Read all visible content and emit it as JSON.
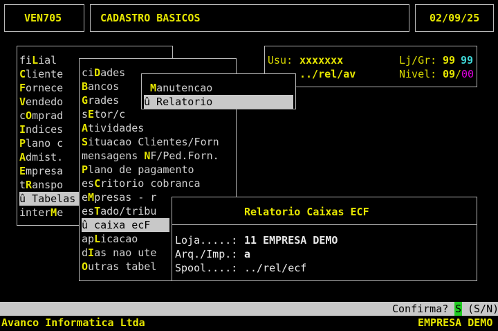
{
  "header": {
    "program": "VEN705",
    "title": "CADASTRO BASICOS",
    "date": "02/09/25"
  },
  "info": {
    "usu_label": "Usu:",
    "usu_value": "xxxxxxx",
    "ljgr_label": "Lj/Gr:",
    "ljgr_value1": "99",
    "ljgr_value2": "99",
    "path": "../rel/av",
    "nivel_label": "Nivel:",
    "nivel_value1": "09",
    "nivel_sep": "/",
    "nivel_value2": "00"
  },
  "menu1": {
    "items": [
      {
        "pre": "fi",
        "hot": "L",
        "post": "ial"
      },
      {
        "pre": "",
        "hot": "C",
        "post": "liente"
      },
      {
        "pre": "",
        "hot": "F",
        "post": "ornece"
      },
      {
        "pre": "",
        "hot": "V",
        "post": "endedo"
      },
      {
        "pre": "c",
        "hot": "O",
        "post": "mprad"
      },
      {
        "pre": "",
        "hot": "I",
        "post": "ndices"
      },
      {
        "pre": "",
        "hot": "P",
        "post": "lano c"
      },
      {
        "pre": "",
        "hot": "A",
        "post": "dmist."
      },
      {
        "pre": "",
        "hot": "E",
        "post": "mpresa"
      },
      {
        "pre": "t",
        "hot": "R",
        "post": "anspo"
      },
      {
        "pre": "û Tabelas",
        "hot": "",
        "post": ""
      },
      {
        "pre": "inter",
        "hot": "M",
        "post": "e"
      }
    ]
  },
  "menu2": {
    "items": [
      {
        "pre": "ci",
        "hot": "D",
        "post": "ades"
      },
      {
        "pre": "",
        "hot": "B",
        "post": "ancos"
      },
      {
        "pre": "",
        "hot": "G",
        "post": "rades"
      },
      {
        "pre": "s",
        "hot": "E",
        "post": "tor/c"
      },
      {
        "pre": "",
        "hot": "A",
        "post": "tividades"
      },
      {
        "pre": "",
        "hot": "S",
        "post": "ituacao Clientes/Forn"
      },
      {
        "pre": "mensagens ",
        "hot": "N",
        "post": "F/Ped.Forn."
      },
      {
        "pre": "",
        "hot": "P",
        "post": "lano de pagamento"
      },
      {
        "pre": "es",
        "hot": "C",
        "post": "ritorio cobranca"
      },
      {
        "pre": "e",
        "hot": "M",
        "post": "presas - r"
      },
      {
        "pre": "es",
        "hot": "T",
        "post": "ado/tribu"
      },
      {
        "pre": "û caixa ecF",
        "hot": "",
        "post": ""
      },
      {
        "pre": "ap",
        "hot": "L",
        "post": "icacao"
      },
      {
        "pre": "d",
        "hot": "I",
        "post": "as nao ute"
      },
      {
        "pre": "",
        "hot": "O",
        "post": "utras tabel"
      }
    ]
  },
  "menu3": {
    "items": [
      {
        "pre": " ",
        "hot": "M",
        "post": "anutencao"
      },
      {
        "pre": "û Relatorio",
        "hot": "",
        "post": ""
      }
    ]
  },
  "dialog": {
    "title": "Relatorio Caixas ECF",
    "loja_label": "Loja.....:",
    "loja_value": "11 EMPRESA DEMO",
    "arq_label": "Arq./Imp.:",
    "arq_value": "a",
    "spool_label": "Spool....:",
    "spool_value": "../rel/ecf"
  },
  "statusbar": {
    "confirm_label": "Confirma?",
    "confirm_value": "S",
    "confirm_options": "(S/N)"
  },
  "footer": {
    "company": "Avanco Informatica Ltda",
    "empresa": "EMPRESA DEMO"
  }
}
